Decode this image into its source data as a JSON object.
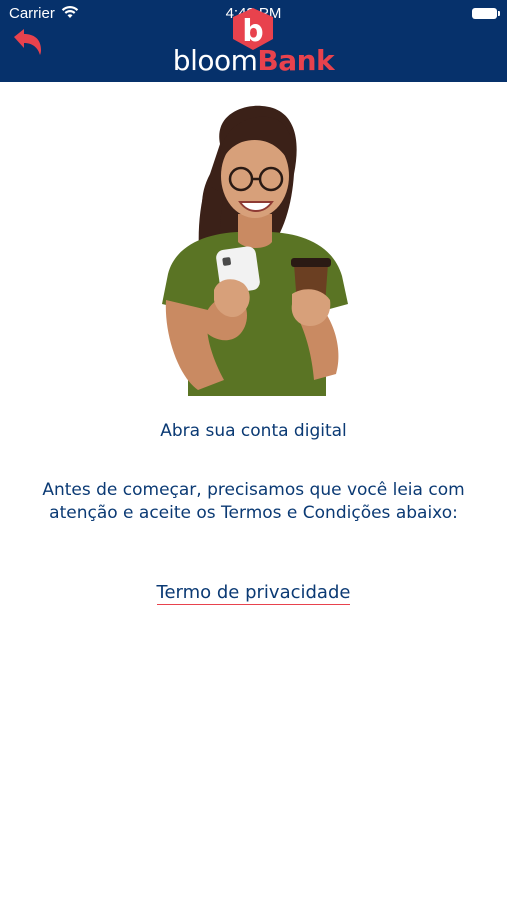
{
  "status_bar": {
    "carrier": "Carrier",
    "time": "4:43 PM"
  },
  "header": {
    "brand_part1": "bloom",
    "brand_part2": "Bank",
    "logo_letter": "b",
    "background_color": "#06316b",
    "accent_color": "#e8424d",
    "back_icon": "back-arrow-icon"
  },
  "main": {
    "title": "Abra sua conta digital",
    "description": "Antes de começar, precisamos que você leia com atenção e aceite os Termos e Condições abaixo:",
    "terms_link": "Termo de privacidade",
    "text_color": "#0b3a74"
  }
}
